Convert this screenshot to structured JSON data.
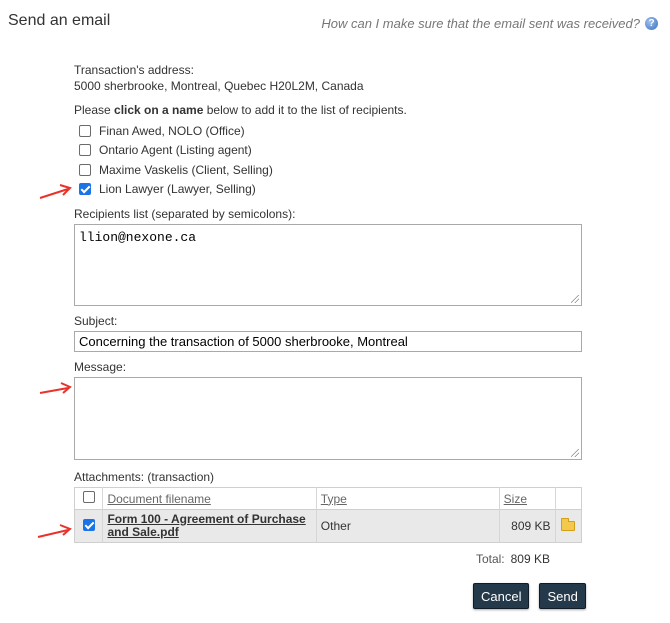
{
  "header": {
    "title": "Send an email",
    "help_text": "How can I make sure that the email sent was received?",
    "help_icon": "question-circle-icon"
  },
  "transaction": {
    "label": "Transaction's address:",
    "address": "5000 sherbrooke, Montreal, Quebec H20L2M, Canada"
  },
  "instructions": {
    "before": "Please ",
    "bold": "click on a name",
    "after": " below to add it to the list of recipients."
  },
  "contacts": [
    {
      "name": "Finan Awed, NOLO (Office)",
      "checked": false
    },
    {
      "name": "Ontario Agent (Listing agent)",
      "checked": false
    },
    {
      "name": "Maxime Vaskelis (Client, Selling)",
      "checked": false
    },
    {
      "name": "Lion Lawyer (Lawyer, Selling)",
      "checked": true
    }
  ],
  "recipients": {
    "label": "Recipients list (separated by semicolons):",
    "value": "llion@nexone.ca"
  },
  "subject": {
    "label": "Subject:",
    "value": "Concerning the transaction of 5000 sherbrooke, Montreal"
  },
  "message": {
    "label": "Message:",
    "value": ""
  },
  "attachments": {
    "label": "Attachments: (transaction)",
    "columns": {
      "filename": "Document filename",
      "type": "Type",
      "size": "Size"
    },
    "rows": [
      {
        "filename_line1": "Form 100 - Agreement of Purchase",
        "filename_line2": "and Sale.pdf",
        "type": "Other",
        "size": "809 KB",
        "checked": true
      }
    ],
    "total_label": "Total:",
    "total_value": "809 KB"
  },
  "buttons": {
    "cancel": "Cancel",
    "send": "Send"
  },
  "colors": {
    "button_bg": "#24394a",
    "annotation_arrow": "#e8322a",
    "checkbox_checked": "#1a73e8"
  }
}
